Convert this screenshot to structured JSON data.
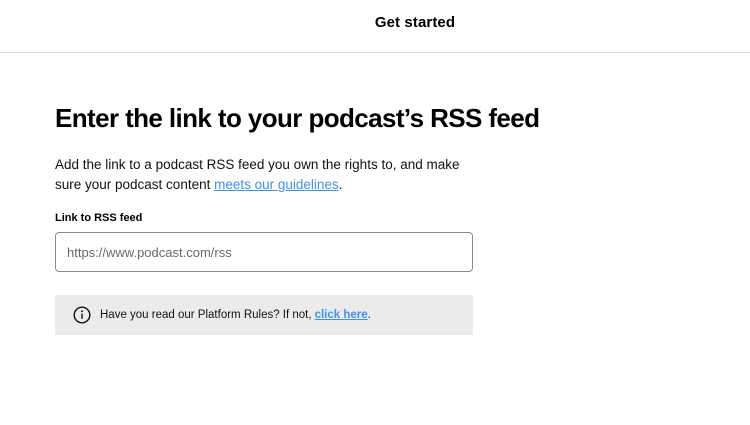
{
  "header": {
    "title": "Get started"
  },
  "main": {
    "title": "Enter the link to your podcast’s RSS feed",
    "description_before_link": "Add the link to a podcast RSS feed you own the rights to, and make sure your podcast content ",
    "guidelines_link": "meets our guidelines",
    "description_after_link": ".",
    "field_label": "Link to RSS feed",
    "rss_input": {
      "placeholder": "https://www.podcast.com/rss",
      "value": ""
    },
    "notice": {
      "icon": "info-icon",
      "text": "Have you read our Platform Rules? If not,",
      "link": "click here",
      "suffix": "."
    }
  },
  "colors": {
    "link": "#3d91f4",
    "notice_background": "#ebebeb",
    "input_border": "#8a8a8a",
    "divider": "#dedede"
  }
}
